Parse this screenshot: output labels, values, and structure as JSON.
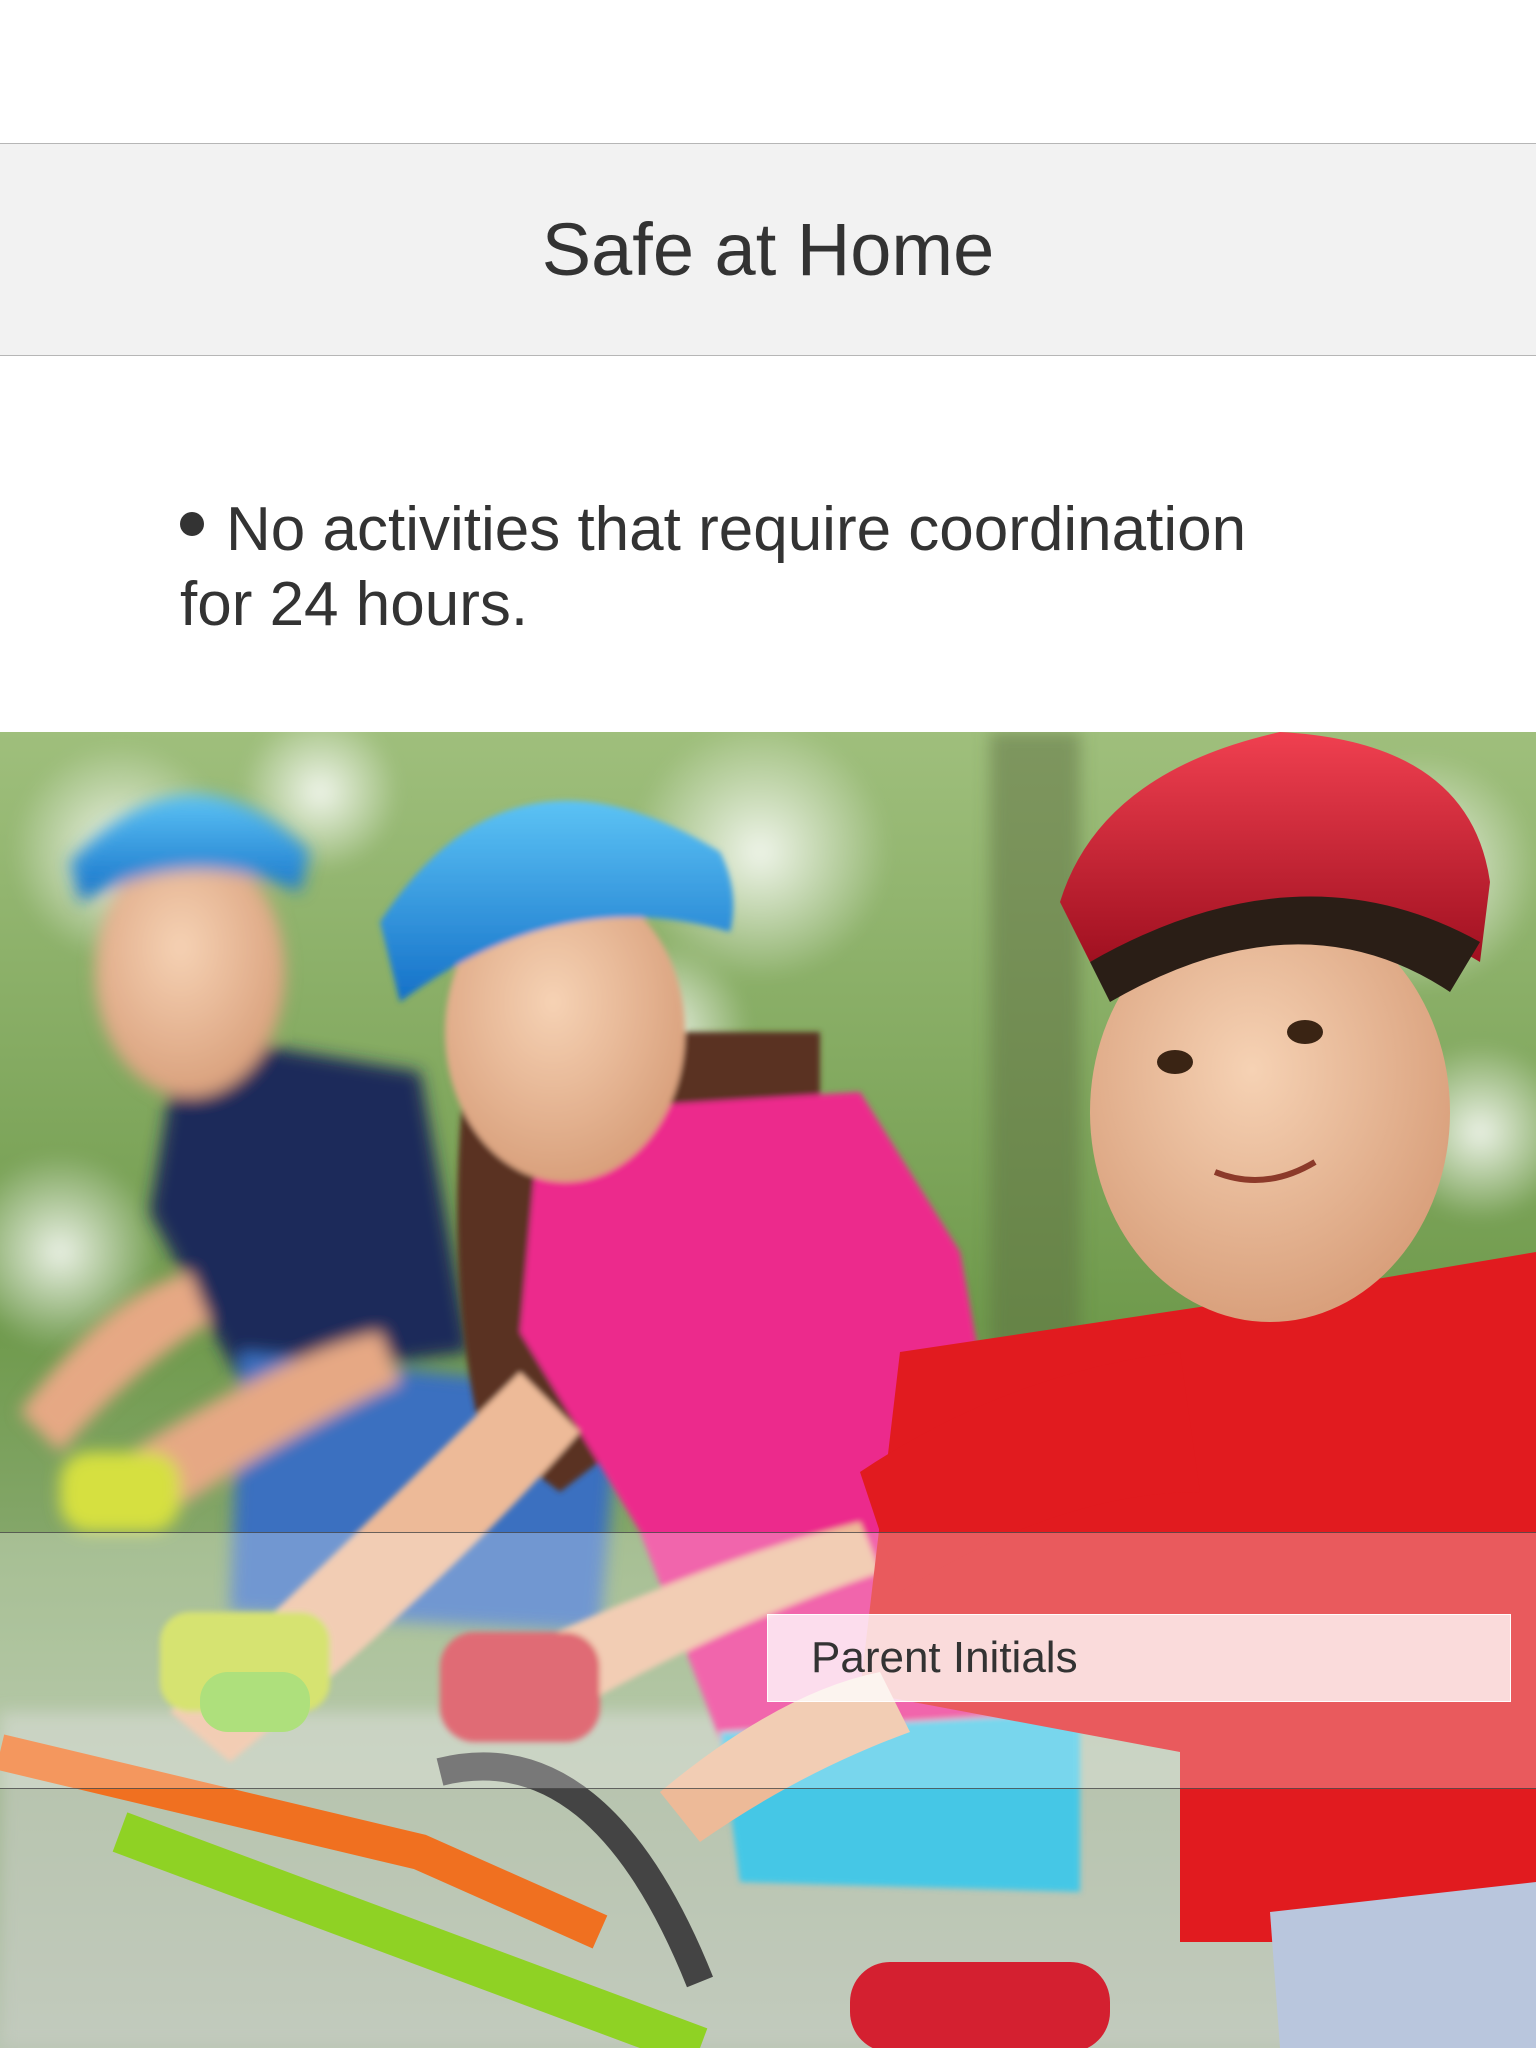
{
  "header": {
    "title": "Safe at Home"
  },
  "instructions": {
    "bullet_text": "No activities that require coordination for 24 hours."
  },
  "photo": {
    "subject": "Three children wearing bike helmets riding bicycles"
  },
  "signature": {
    "initials_placeholder": "Parent Initials",
    "initials_value": ""
  },
  "colors": {
    "header_background": "#f2f2f2",
    "text": "#333333",
    "divider": "#b6b6b6"
  }
}
